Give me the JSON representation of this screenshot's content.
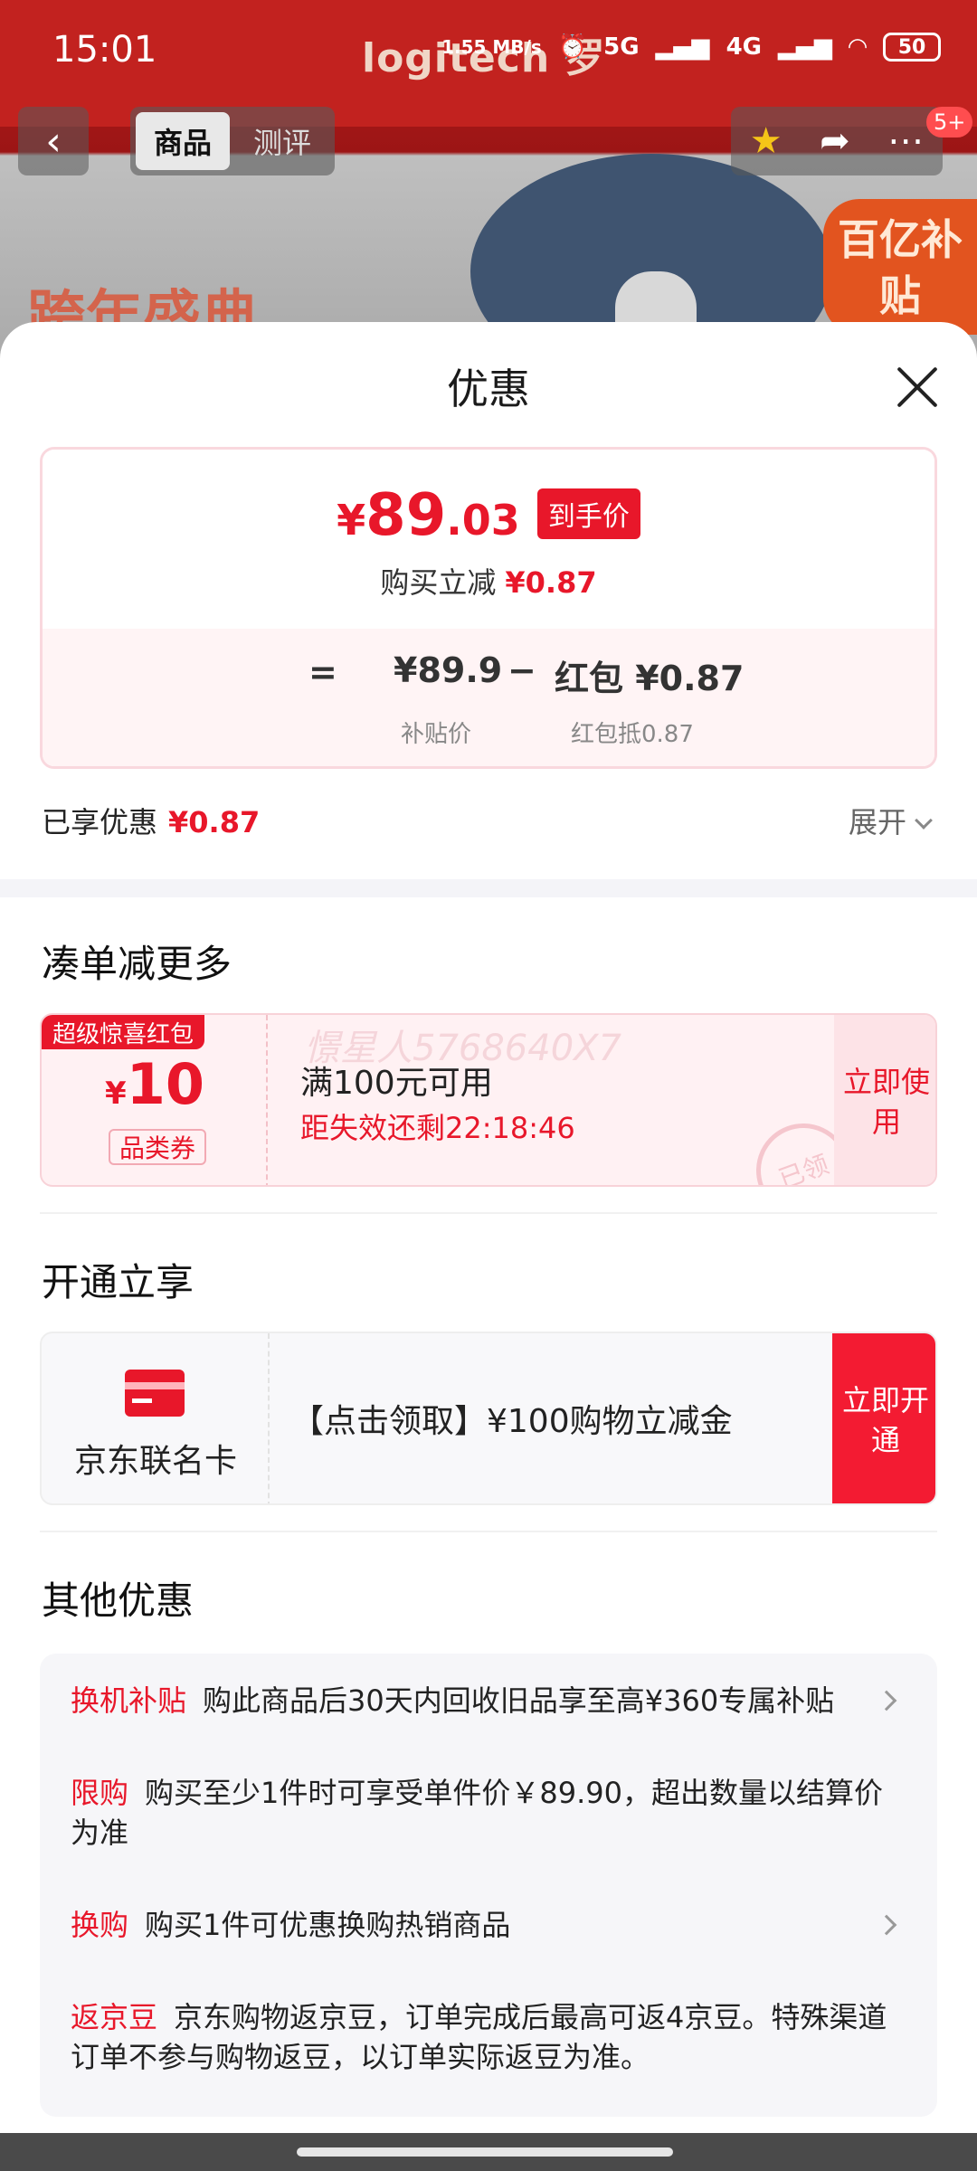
{
  "status_bar": {
    "time": "15:01",
    "net_speed": "1.55 MB/s",
    "sig1": "5G",
    "sig2": "4G",
    "battery": "50"
  },
  "background": {
    "brand": "logitech 罗",
    "festival": "跨年盛典",
    "subsidy_badge": "百亿补贴"
  },
  "top_nav": {
    "tab_product": "商品",
    "tab_review": "测评",
    "cart_badge": "5+"
  },
  "sheet": {
    "title": "优惠",
    "price_card": {
      "currency": "¥",
      "final_int": "89",
      "final_dec": ".03",
      "final_tag": "到手价",
      "reduce_label": "购买立减",
      "reduce_amount": "¥0.87",
      "eq": "=",
      "subsidy_price": "¥89.9",
      "minus": "−",
      "redpacket_price": "红包 ¥0.87",
      "subsidy_label": "补贴价",
      "redpacket_label": "红包抵0.87"
    },
    "enjoyed_label": "已享优惠",
    "enjoyed_amount": "¥0.87",
    "expand_label": "展开"
  },
  "section_more": {
    "title": "凑单减更多",
    "coupon": {
      "badge": "超级惊喜红包",
      "currency": "¥",
      "amount": "10",
      "category": "品类券",
      "watermark": "憬星人5768640X7",
      "condition": "满100元可用",
      "timer": "距失效还剩22:18:46",
      "stamp": "已领",
      "use_label": "立即使用"
    }
  },
  "section_open": {
    "title": "开通立享",
    "card_name": "京东联名卡",
    "card_desc": "【点击领取】¥100购物立减金",
    "open_label": "立即开通"
  },
  "section_others": {
    "title": "其他优惠",
    "items": [
      {
        "tag": "换机补贴",
        "text": "购此商品后30天内回收旧品享至高¥360专属补贴"
      },
      {
        "tag": "限购",
        "text": "购买至少1件时可享受单件价￥89.90，超出数量以结算价为准"
      },
      {
        "tag": "换购",
        "text": "购买1件可优惠换购热销商品"
      },
      {
        "tag": "返京豆",
        "text": "京东购物返京豆，订单完成后最高可返4京豆。特殊渠道订单不参与购物返豆，以订单实际返豆为准。"
      }
    ]
  }
}
